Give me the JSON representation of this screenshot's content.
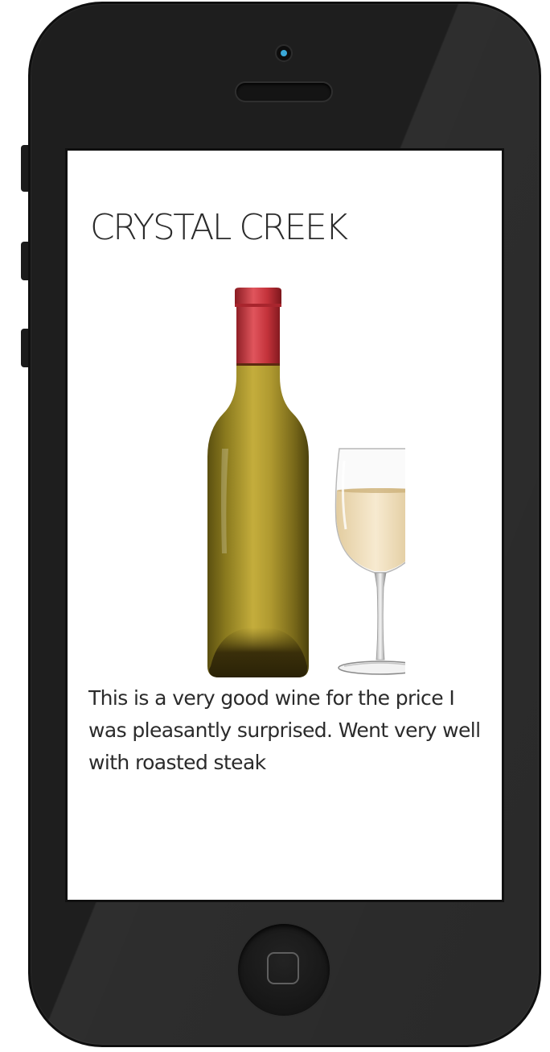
{
  "app": {
    "title": "CRYSTAL CREEK"
  },
  "product": {
    "image": "wine-bottle-and-glass",
    "review": "This is a very good wine for the price I was pleasantly surprised. Went very well with roasted steak"
  },
  "device": {
    "model": "iphone-frame",
    "camera_color": "#3aa8d8"
  },
  "colors": {
    "bottle_glass": "#b3a030",
    "bottle_capsule": "#c8323a",
    "wine": "#f1dfb6",
    "text": "#2b2b2b"
  }
}
